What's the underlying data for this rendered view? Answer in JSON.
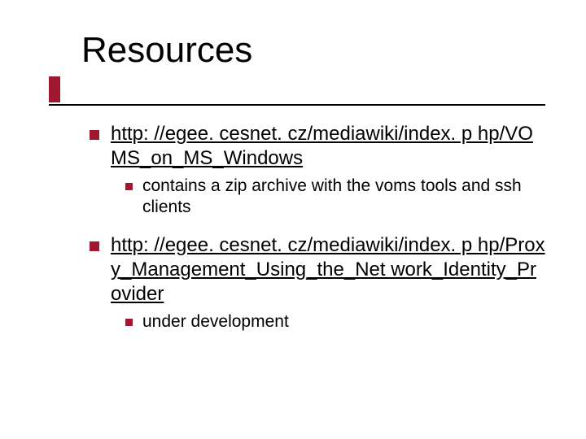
{
  "title": "Resources",
  "items": [
    {
      "link": "http: //egee. cesnet. cz/mediawiki/index. p hp/VOMS_on_MS_Windows",
      "sub": "contains a zip archive with the voms tools and ssh clients"
    },
    {
      "link": "http: //egee. cesnet. cz/mediawiki/index. p hp/Proxy_Management_Using_the_Net work_Identity_Provider",
      "sub": "under development"
    }
  ]
}
